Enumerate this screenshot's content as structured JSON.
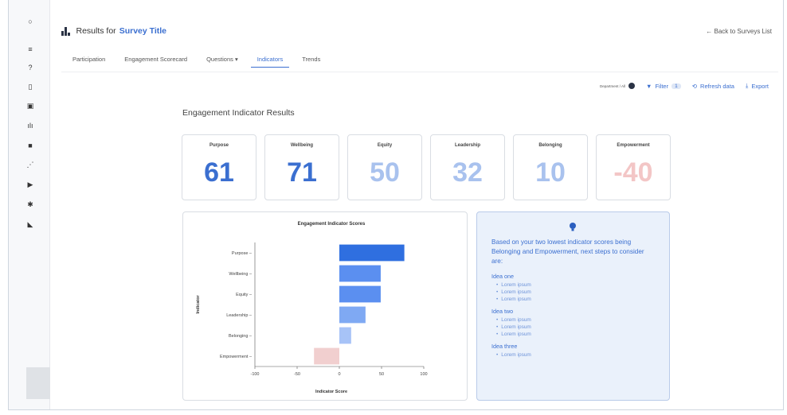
{
  "header": {
    "results_label": "Results for",
    "survey_title": "Survey Title",
    "back_link": "← Back to Surveys List"
  },
  "tabs": [
    {
      "label": "Participation",
      "active": false
    },
    {
      "label": "Engagement Scorecard",
      "active": false
    },
    {
      "label": "Questions ▾",
      "active": false
    },
    {
      "label": "Indicators",
      "active": true
    },
    {
      "label": "Trends",
      "active": false
    }
  ],
  "toolbar": {
    "department_label": "Department / All",
    "filter_label": "Filter",
    "filter_count": "1",
    "refresh_label": "Refresh data",
    "export_label": "Export"
  },
  "section_title": "Engagement Indicator Results",
  "cards": [
    {
      "name": "Purpose",
      "value": "61",
      "color": "#3b6fd0"
    },
    {
      "name": "Wellbeing",
      "value": "71",
      "color": "#3b6fd0"
    },
    {
      "name": "Equity",
      "value": "50",
      "color": "#a9c2ee"
    },
    {
      "name": "Leadership",
      "value": "32",
      "color": "#a9c2ee"
    },
    {
      "name": "Belonging",
      "value": "10",
      "color": "#a9c2ee"
    },
    {
      "name": "Empowerment",
      "value": "-40",
      "color": "#f3c6c6"
    }
  ],
  "chart_data": {
    "type": "bar",
    "orientation": "horizontal",
    "title": "Engagement Indicator Scores",
    "xlabel": "Indicator Score",
    "ylabel": "Indicator",
    "categories": [
      "Purpose",
      "Wellbeing",
      "Equity",
      "Leadership",
      "Belonging",
      "Empowerment"
    ],
    "values": [
      77,
      49,
      49,
      31,
      14,
      -30
    ],
    "colors": [
      "#2f6fe0",
      "#5b8ff0",
      "#5b8ff0",
      "#7fa9f3",
      "#a7c3f7",
      "#f1cfcf"
    ],
    "xlim": [
      -100,
      100
    ],
    "xticks": [
      "-100",
      "-50",
      "0",
      "50",
      "100"
    ],
    "grid": false
  },
  "info": {
    "intro": "Based on your two lowest indicator scores being Belonging and Empowerment, next steps to consider are:",
    "ideas": [
      {
        "title": "Idea one",
        "items": [
          "Lorem ipsum",
          "Lorem ipsum",
          "Lorem ipsum"
        ]
      },
      {
        "title": "Idea two",
        "items": [
          "Lorem ipsum",
          "Lorem ipsum",
          "Lorem ipsum"
        ]
      },
      {
        "title": "Idea three",
        "items": [
          "Lorem ipsum"
        ]
      }
    ]
  }
}
